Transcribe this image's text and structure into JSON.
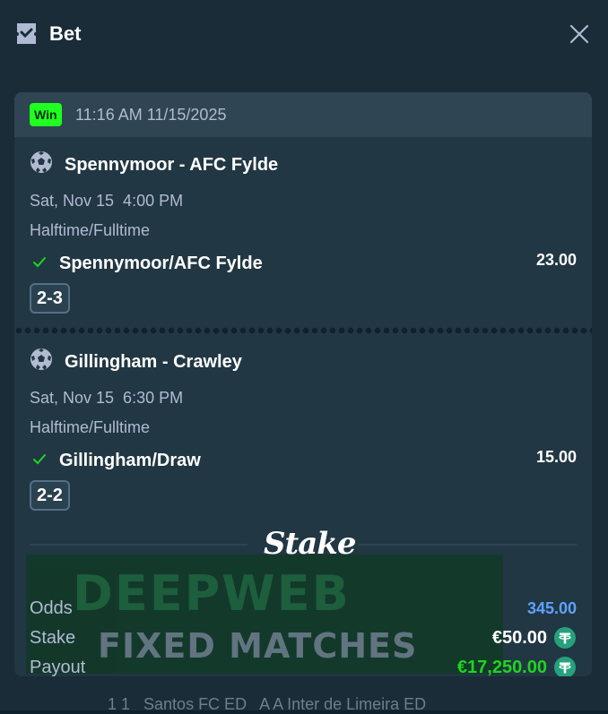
{
  "header": {
    "title": "Bet",
    "icon": "ticket-icon",
    "close_icon": "close-icon"
  },
  "bet": {
    "status": "Win",
    "status_color": "#1fff20",
    "timestamp": "11:16 AM 11/15/2025",
    "legs": [
      {
        "match": "Spennymoor - AFC Fylde",
        "date": "Sat, Nov 15  4:00 PM",
        "market": "Halftime/Fulltime",
        "selection": "Spennymoor/AFC Fylde",
        "odds": "23.00",
        "score": "2-3"
      },
      {
        "match": "Gillingham - Crawley",
        "date": "Sat, Nov 15  6:30 PM",
        "market": "Halftime/Fulltime",
        "selection": "Gillingham/Draw",
        "odds": "15.00",
        "score": "2-2"
      }
    ],
    "brand": "Stake",
    "watermark_line1": "DEEPWEB",
    "watermark_line2": "FIXED MATCHES",
    "summary": {
      "odds_label": "Odds",
      "odds_value": "345.00",
      "odds_color": "#5ea2ff",
      "stake_label": "Stake",
      "stake_value": "€50.00",
      "payout_label": "Payout",
      "payout_value": "€17,250.00",
      "payout_color": "#1fd51f",
      "currency_icon": "tether-icon"
    }
  },
  "background": {
    "partial_text": "1 1   Santos FC ED   A A Inter de Limeira ED"
  }
}
